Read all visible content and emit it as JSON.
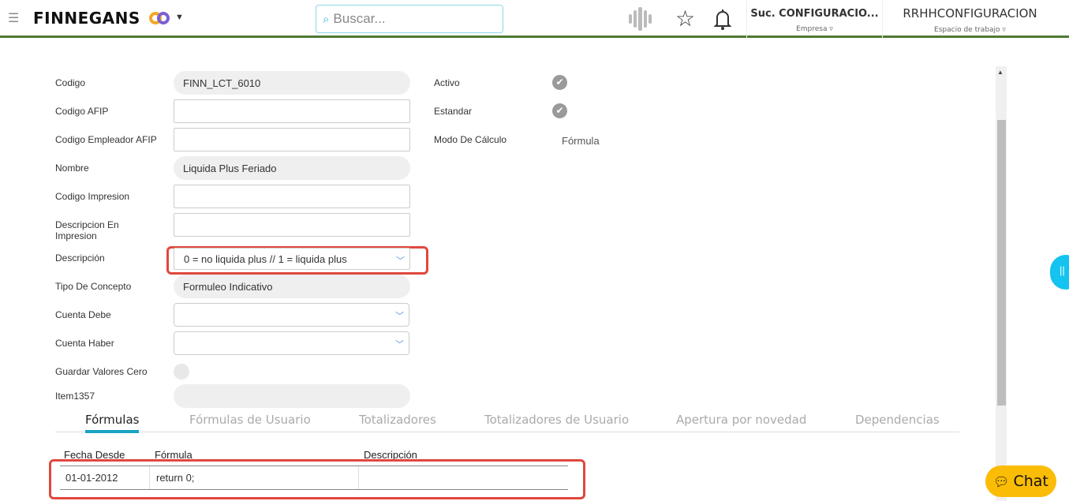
{
  "header": {
    "brand": "FINNEGANS",
    "search_placeholder": "Buscar...",
    "company": "Suc. CONFIGURACIO...",
    "company_label": "Empresa ▿",
    "workspace": "RRHHCONFIGURACION",
    "workspace_label": "Espacio de trabajo ▿"
  },
  "form": {
    "codigo": {
      "label": "Codigo",
      "value": "FINN_LCT_6010"
    },
    "codigo_afip": {
      "label": "Codigo AFIP",
      "value": ""
    },
    "codigo_empleador_afip": {
      "label": "Codigo Empleador AFIP",
      "value": ""
    },
    "nombre": {
      "label": "Nombre",
      "value": "Liquida Plus Feriado"
    },
    "codigo_impresion": {
      "label": "Codigo Impresion",
      "value": ""
    },
    "descripcion_impresion": {
      "label": "Descripcion En Impresion",
      "value": ""
    },
    "descripcion": {
      "label": "Descripción",
      "value": "0 = no liquida plus // 1 = liquida plus"
    },
    "tipo_concepto": {
      "label": "Tipo De Concepto",
      "value": "Formuleo Indicativo"
    },
    "cuenta_debe": {
      "label": "Cuenta Debe",
      "value": ""
    },
    "cuenta_haber": {
      "label": "Cuenta Haber",
      "value": ""
    },
    "guardar_valores_cero": {
      "label": "Guardar Valores Cero"
    },
    "item1357": {
      "label": "Item1357",
      "value": ""
    },
    "activo": {
      "label": "Activo"
    },
    "estandar": {
      "label": "Estandar"
    },
    "modo_calculo": {
      "label": "Modo De Cálculo",
      "value": "Fórmula"
    }
  },
  "tabs": [
    "Fórmulas",
    "Fórmulas de Usuario",
    "Totalizadores",
    "Totalizadores de Usuario",
    "Apertura por novedad",
    "Dependencias"
  ],
  "table": {
    "headers": [
      "Fecha Desde",
      "Fórmula",
      "Descripción"
    ],
    "rows": [
      [
        "01-01-2012",
        "return 0;",
        ""
      ]
    ]
  },
  "chat": {
    "label": "Chat"
  },
  "side_handle": "||"
}
